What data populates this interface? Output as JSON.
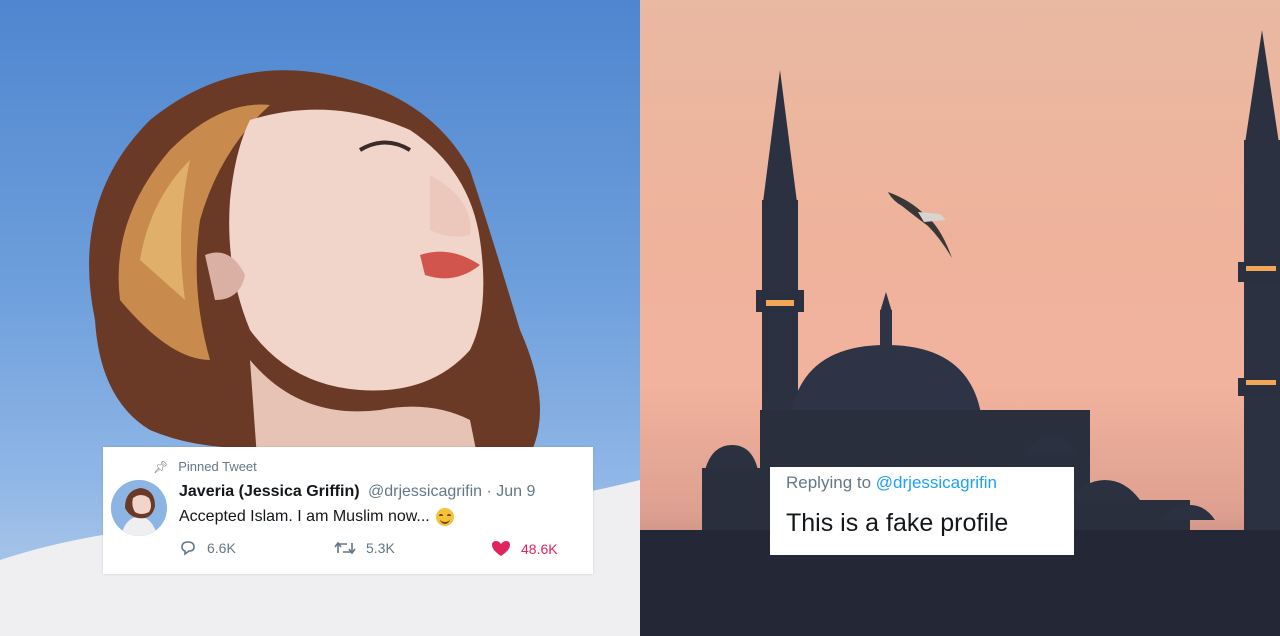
{
  "tweet": {
    "pinned_label": "Pinned Tweet",
    "display_name": "Javeria (Jessica Griffin)",
    "handle_date": "@drjessicagrifin · Jun 9",
    "text": "Accepted Islam. I am Muslim now...",
    "replies": "6.6K",
    "retweets": "5.3K",
    "likes": "48.6K",
    "icons": {
      "pin": "pin-icon",
      "reply": "comment-icon",
      "retweet": "retweet-icon",
      "like": "heart-icon",
      "emoji": "smiling-face-emoji"
    }
  },
  "reply": {
    "replying_to": "Replying to",
    "mention": "@drjessicagrifin",
    "text": "This is a fake profile"
  },
  "colors": {
    "twitter_blue": "#1da1f2",
    "like_red": "#e0245e",
    "muted_gray": "#657786",
    "text_dark": "#14171a"
  }
}
